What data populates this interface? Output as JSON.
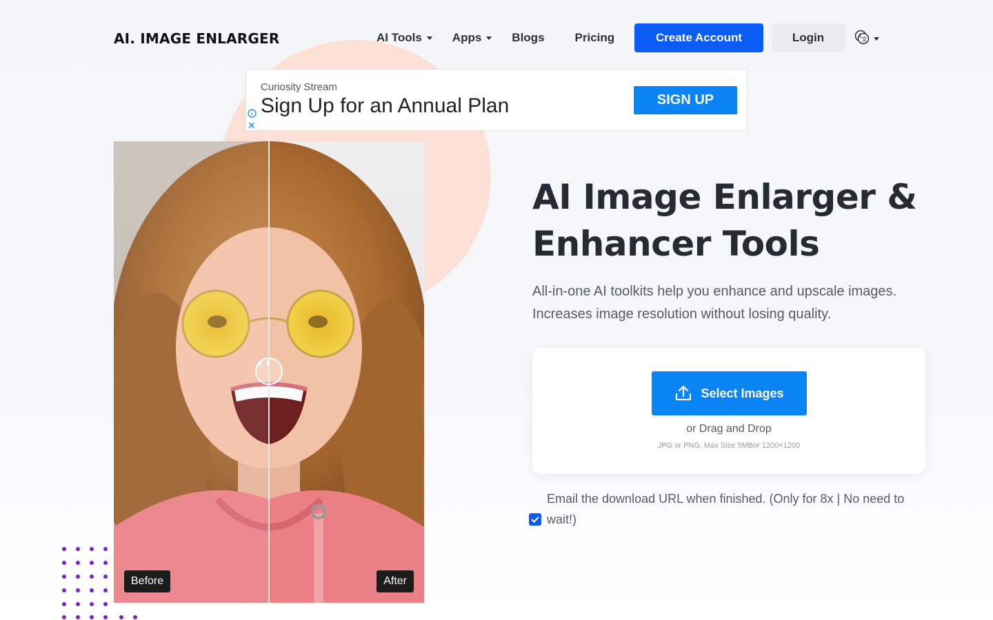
{
  "header": {
    "logo": "AI. IMAGE ENLARGER",
    "nav": [
      {
        "label": "AI Tools",
        "dropdown": true
      },
      {
        "label": "Apps",
        "dropdown": true
      },
      {
        "label": "Blogs",
        "dropdown": false
      },
      {
        "label": "Pricing",
        "dropdown": false
      }
    ],
    "create_account": "Create Account",
    "login": "Login",
    "language_icon": "language-icon"
  },
  "ad": {
    "brand": "Curiosity Stream",
    "headline": "Sign Up for an Annual Plan",
    "cta": "SIGN UP"
  },
  "compare": {
    "before_label": "Before",
    "after_label": "After"
  },
  "hero": {
    "title": "AI Image Enlarger & Enhancer Tools",
    "subtitle": "All-in-one AI toolkits help you enhance and upscale images. Increases image resolution without losing quality."
  },
  "upload": {
    "button_label": "Select Images",
    "drag_text": "or Drag and Drop",
    "limit_text": "JPG or PNG. Max Size 5MBor 1200×1200"
  },
  "email_option": {
    "label": "Email the download URL when finished. (Only for 8x | No need to wait!)",
    "checked": true
  },
  "colors": {
    "primary": "#0a5cf5",
    "upload_blue": "#0a84f5",
    "circle": "#fde0d5",
    "dots": "#7b22c9"
  }
}
